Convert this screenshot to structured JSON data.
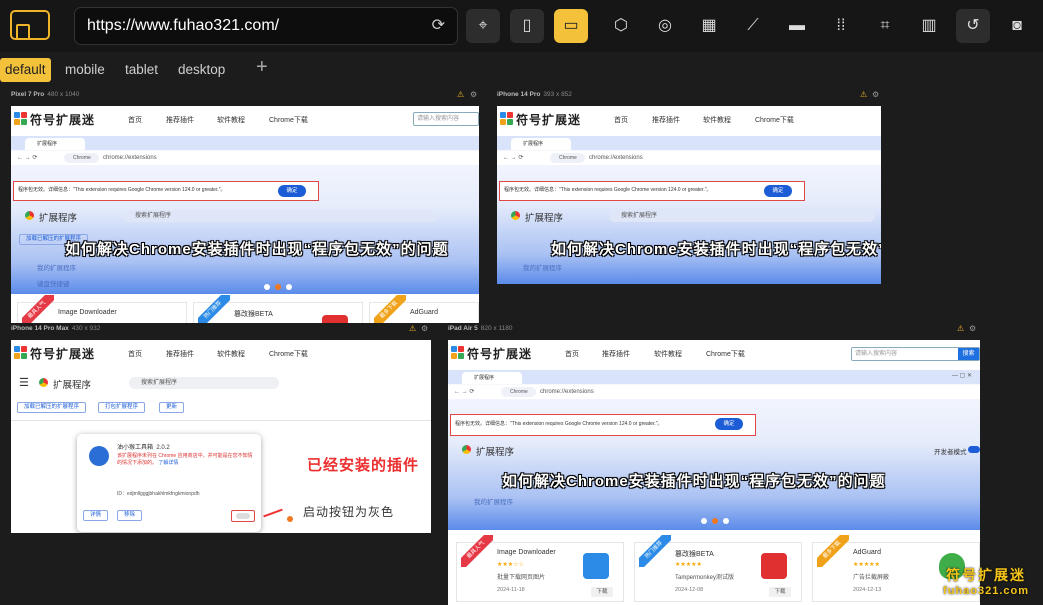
{
  "url": "https://www.fuhao321.com/",
  "tabs": [
    "default",
    "mobile",
    "tablet",
    "desktop"
  ],
  "add_tab": "+",
  "devices": [
    {
      "name": "Pixel 7 Pro",
      "dim": "480 x 1040"
    },
    {
      "name": "iPhone 14 Pro",
      "dim": "393 x 852"
    },
    {
      "name": "iPhone 14 Pro Max",
      "dim": "430 x 932"
    },
    {
      "name": "iPad Air 5",
      "dim": "820 x 1180"
    }
  ],
  "site": {
    "name": "符号扩展迷",
    "nav": [
      "首页",
      "推荐插件",
      "软件教程",
      "Chrome下载"
    ],
    "search_placeholder": "请输入搜索内容",
    "search_btn": "搜索"
  },
  "banner": {
    "tab_label": "扩展程序",
    "chrome_pill": "Chrome",
    "address": "chrome://extensions",
    "error": "程序包无效。详细信息：\"This extension requires Google Chrome version 124.0 or greater.\"。",
    "ok": "确定",
    "ext_title": "扩展程序",
    "search_ext": "搜索扩展程序",
    "btn_load": "加载已解压的扩展程序",
    "btn_pack": "打包扩展程序",
    "btn_update": "更新",
    "my_ext": "我的扩展程序",
    "shortcuts": "键盘快捷键",
    "dev_mode": "开发者模式",
    "headline": "如何解决Chrome安装插件时出现“程序包无效”的问题"
  },
  "cards": [
    {
      "ribbon": "最具人气",
      "title": "Image Downloader",
      "stars": "★★★☆☆",
      "desc": "批量下载网页图片",
      "date": "2024-11-18",
      "dl": "下载",
      "color": "#e63946"
    },
    {
      "ribbon": "热门推荐",
      "title": "篡改猴BETA",
      "stars": "★★★★★",
      "desc": "Tampermonkey测试版",
      "date": "2024-12-08",
      "dl": "下载",
      "color": "#2b8be6"
    },
    {
      "ribbon": "最多下载",
      "title": "AdGuard",
      "stars": "★★★★★",
      "desc": "广告拦截屏蔽",
      "date": "2024-12-13",
      "dl": "下载",
      "color": "#f0a21a"
    }
  ],
  "pixel_cards": [
    "Image Downloader",
    "篡改猴BETA",
    "AdGuard"
  ],
  "popup": {
    "name": "油小猴工具箱",
    "version": "2.0.2",
    "msg": "该扩展程序未列在 Chrome 应用商店中，并可能是在您不知情的情况下添加的。",
    "more": "了解详情",
    "id": "ID：edjmllgggjbhakhlmkfngkmionpdh",
    "detail": "详情",
    "remove": "移除"
  },
  "annot_installed": "已经安装的插件",
  "annot_gray": "启动按钮为灰色",
  "watermark": {
    "cn": "符号扩展迷",
    "en": "fuhao321.com"
  }
}
